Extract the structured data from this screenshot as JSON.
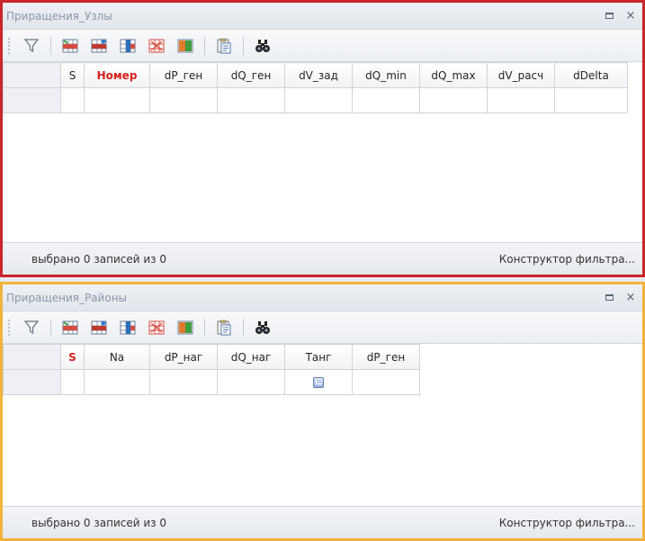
{
  "panel1": {
    "title": "Приращения_Узлы",
    "columns": [
      "",
      "S",
      "Номер",
      "dP_ген",
      "dQ_ген",
      "dV_зад",
      "dQ_min",
      "dQ_max",
      "dV_расч",
      "dDelta"
    ],
    "status_text": "выбрано 0 записей из 0",
    "filter_text": "Конструктор фильтра..."
  },
  "panel2": {
    "title": "Приращения_Районы",
    "columns": [
      "",
      "S",
      "Na",
      "dP_наг",
      "dQ_наг",
      "Танг",
      "dP_ген"
    ],
    "status_text": "выбрано 0 записей из 0",
    "filter_text": "Конструктор фильтра..."
  },
  "controls": {
    "close": "×"
  },
  "colors": {
    "panel1_border": "#c8272c",
    "panel2_border": "#f2b33d",
    "required_column": "#d8201c"
  },
  "icons": [
    "filter-icon",
    "insert-row-icon",
    "delete-row-icon",
    "copy-row-icon",
    "columns-icon",
    "export-icon",
    "copy-clipboard-icon",
    "binoculars-icon"
  ]
}
